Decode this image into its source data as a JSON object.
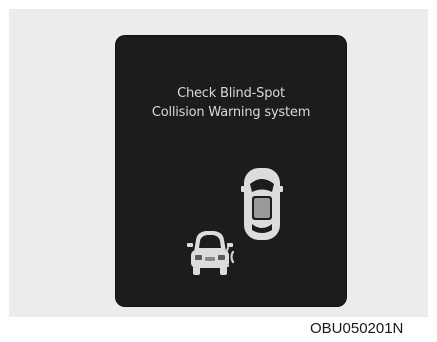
{
  "warning": {
    "line1": "Check Blind-Spot",
    "line2": "Collision Warning system"
  },
  "illustration": {
    "own_vehicle_icon": "car-top-view-icon",
    "adjacent_vehicle_icon": "car-front-view-icon",
    "signal_icon": "radar-waves-icon"
  },
  "figure_code": "OBU050201N",
  "colors": {
    "screen_background": "#1c1c1c",
    "text": "#d8d8d8",
    "panel_background": "#ececec"
  }
}
